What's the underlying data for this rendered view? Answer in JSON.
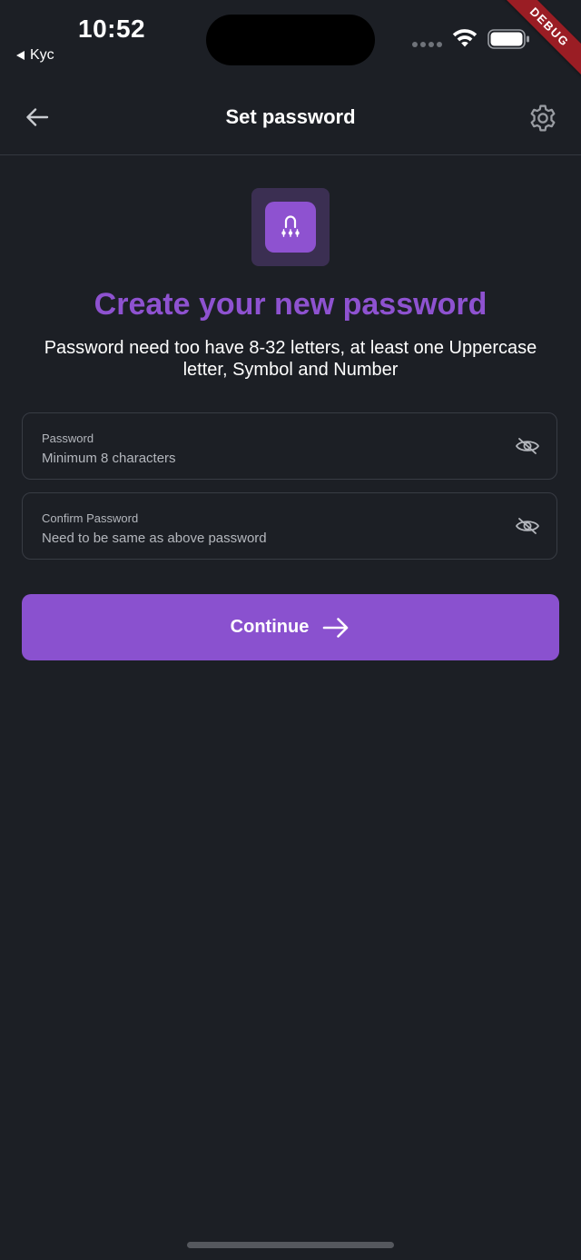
{
  "status_bar": {
    "time": "10:52",
    "back_app": "Kyc",
    "debug_banner": "DEBUG",
    "icons": [
      "signal-dots-icon",
      "wifi-icon",
      "battery-icon"
    ]
  },
  "header": {
    "title": "Set password",
    "back_icon": "arrow-left-icon",
    "settings_icon": "gear-icon"
  },
  "hero": {
    "icon": "password-key-icon",
    "heading": "Create your new password",
    "subtitle": "Password need too have 8-32 letters, at least one Uppercase letter, Symbol and Number"
  },
  "form": {
    "password": {
      "label": "Password",
      "placeholder": "Minimum 8 characters",
      "value": "",
      "toggle_icon": "eye-off-icon"
    },
    "confirm_password": {
      "label": "Confirm Password",
      "placeholder": "Need to be same as above password",
      "value": "",
      "toggle_icon": "eye-off-icon"
    }
  },
  "actions": {
    "continue_label": "Continue",
    "continue_icon": "arrow-right-icon"
  },
  "colors": {
    "background": "#1c1f25",
    "accent": "#8e52d0",
    "accent_button": "#8a51cf",
    "icon_box": "#3b2f52",
    "field_border": "#383c44",
    "muted_text": "#b4b7bd",
    "debug_ribbon": "#9a1d24"
  }
}
